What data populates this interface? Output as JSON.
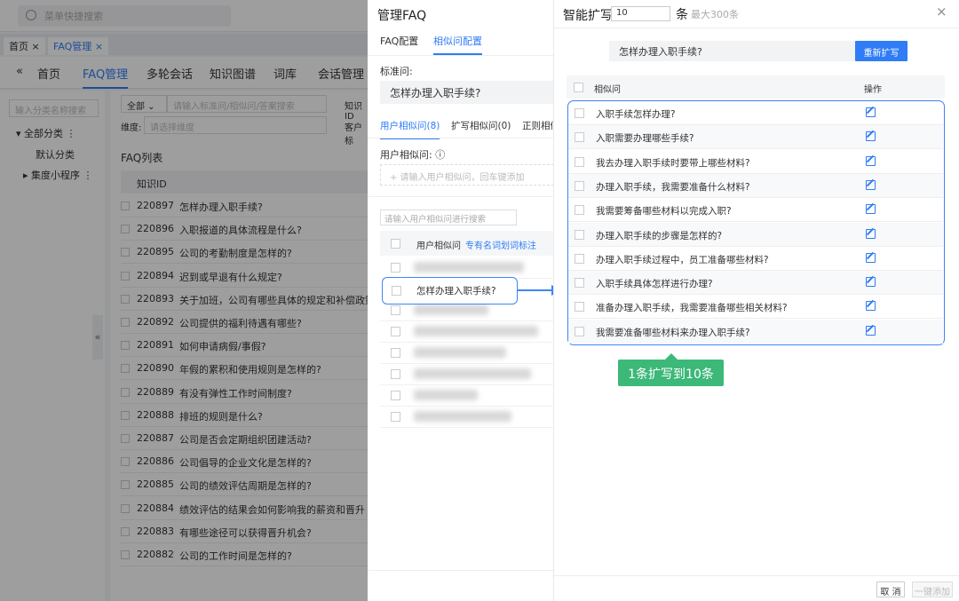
{
  "background_app": {
    "search_placeholder": "菜单快捷搜索",
    "tabs": [
      "首页",
      "FAQ管理"
    ],
    "tab_close": "×",
    "nav_collapse": "«",
    "nav": [
      "首页",
      "FAQ管理",
      "多轮会话",
      "知识图谱",
      "词库",
      "会话管理"
    ],
    "active_nav": "FAQ管理",
    "sidebar": {
      "search_placeholder": "输入分类名称搜索",
      "items": [
        "全部分类",
        "默认分类",
        "集度小程序"
      ],
      "collapse": "«"
    },
    "filters": {
      "scope_select": "全部",
      "search_placeholder": "请输入标准问/相似问/答案搜索",
      "dim_label": "维度:",
      "dim_placeholder": "请选择维度",
      "knowledge_label": "知识ID",
      "customer_label": "客户标"
    },
    "list_title": "FAQ列表",
    "table_header": "知识ID",
    "rows": [
      {
        "id": "220897",
        "q": "怎样办理入职手续?"
      },
      {
        "id": "220896",
        "q": "入职报道的具体流程是什么?"
      },
      {
        "id": "220895",
        "q": "公司的考勤制度是怎样的?"
      },
      {
        "id": "220894",
        "q": "迟到或早退有什么规定?"
      },
      {
        "id": "220893",
        "q": "关于加班，公司有哪些具体的规定和补偿政策?"
      },
      {
        "id": "220892",
        "q": "公司提供的福利待遇有哪些?"
      },
      {
        "id": "220891",
        "q": "如何申请病假/事假?"
      },
      {
        "id": "220890",
        "q": "年假的累积和使用规则是怎样的?"
      },
      {
        "id": "220889",
        "q": "有没有弹性工作时间制度?"
      },
      {
        "id": "220888",
        "q": "排班的规则是什么?"
      },
      {
        "id": "220887",
        "q": "公司是否会定期组织团建活动?"
      },
      {
        "id": "220886",
        "q": "公司倡导的企业文化是怎样的?"
      },
      {
        "id": "220885",
        "q": "公司的绩效评估周期是怎样的?"
      },
      {
        "id": "220884",
        "q": "绩效评估的结果会如何影响我的薪资和晋升"
      },
      {
        "id": "220883",
        "q": "有哪些途径可以获得晋升机会?"
      },
      {
        "id": "220882",
        "q": "公司的工作时间是怎样的?"
      }
    ]
  },
  "middle_panel": {
    "title": "管理FAQ",
    "tabs": [
      "FAQ配置",
      "相似问配置"
    ],
    "active_tab": "相似问配置",
    "standard_label": "标准问:",
    "standard_value": "怎样办理入职手续?",
    "sub_tabs": [
      "用户相似问(8)",
      "扩写相似问(0)",
      "正则相似"
    ],
    "user_label": "用户相似问:",
    "info_icon": "ⓘ",
    "user_input_placeholder": "+ 请输入用户相似问，回车键添加",
    "search_placeholder": "请输入用户相似问进行搜索",
    "list_header": "用户相似问",
    "list_header_link": "专有名词划词标注",
    "highlighted_item": "怎样办理入职手续?"
  },
  "right_panel": {
    "title": "智能扩写",
    "count_value": "10",
    "count_unit": "条",
    "max_hint": "最大300条",
    "close": "×",
    "question": "怎样办理入职手续?",
    "regen_button": "重新扩写",
    "col_similar": "相似问",
    "col_action": "操作",
    "items": [
      "入职手续怎样办理?",
      "入职需要办理哪些手续?",
      "我去办理入职手续时要带上哪些材料?",
      "办理入职手续，我需要准备什么材料?",
      "我需要筹备哪些材料以完成入职?",
      "办理入职手续的步骤是怎样的?",
      "办理入职手续过程中，员工准备哪些材料?",
      "入职手续具体怎样进行办理?",
      "准备办理入职手续，我需要准备哪些相关材料?",
      "我需要准备哪些材料来办理入职手续?"
    ],
    "badge": "1条扩写到10条",
    "cancel_button": "取 消",
    "add_all_button": "一键添加"
  },
  "colors": {
    "accent": "#2f7cf6",
    "badge": "#3cb878"
  }
}
